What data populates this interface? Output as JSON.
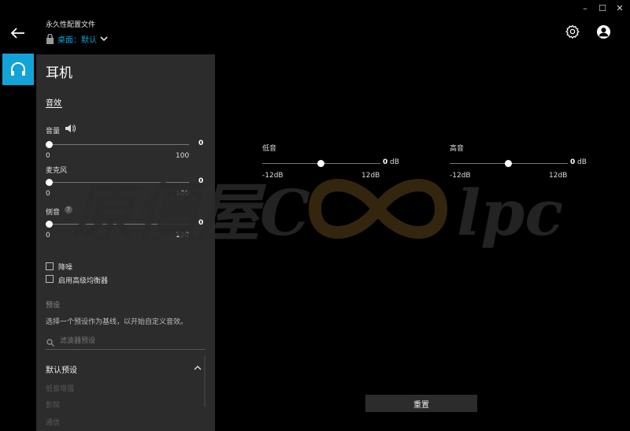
{
  "window": {
    "minimize": "–",
    "maximize": "☐",
    "close": "✕"
  },
  "header": {
    "back_icon": "arrow-left-icon",
    "profile_label": "永久性配置文件",
    "profile_name": "桌面：默认",
    "lock_icon": "lock-icon",
    "chevron": "chevron-down-icon",
    "settings_icon": "gear-icon",
    "account_icon": "user-icon"
  },
  "sidebar": {
    "active_item": "headphones-icon",
    "accent": "#12a3d8"
  },
  "panel": {
    "title": "耳机",
    "tab": "音效",
    "volume": {
      "label": "音量",
      "value": "0",
      "min": "0",
      "max": "100",
      "level": 0
    },
    "mic": {
      "label": "麦克风",
      "value": "0",
      "min": "0",
      "max": "100",
      "level": 0
    },
    "sidetone": {
      "label": "侧音",
      "help": "?",
      "value": "0",
      "min": "0",
      "max": "100",
      "level": 0
    },
    "noise_reduction": {
      "label": "降噪",
      "checked": false
    },
    "advanced_eq": {
      "label": "启用高级均衡器",
      "checked": false
    },
    "preset_heading": "预设",
    "preset_hint": "选择一个预设作为基线，以开始自定义音效。",
    "search_placeholder": "滤波器预设",
    "default_presets_label": "默认预设",
    "preset_items": [
      "低音增强",
      "影院",
      "通信"
    ]
  },
  "eq": {
    "bass": {
      "label": "低音",
      "value": "0",
      "unit": "dB",
      "min": "-12dB",
      "max": "12dB"
    },
    "treble": {
      "label": "高音",
      "value": "0",
      "unit": "dB",
      "min": "-12dB",
      "max": "12dB"
    }
  },
  "reset_label": "重置",
  "watermark": "原價屋Coolpc"
}
